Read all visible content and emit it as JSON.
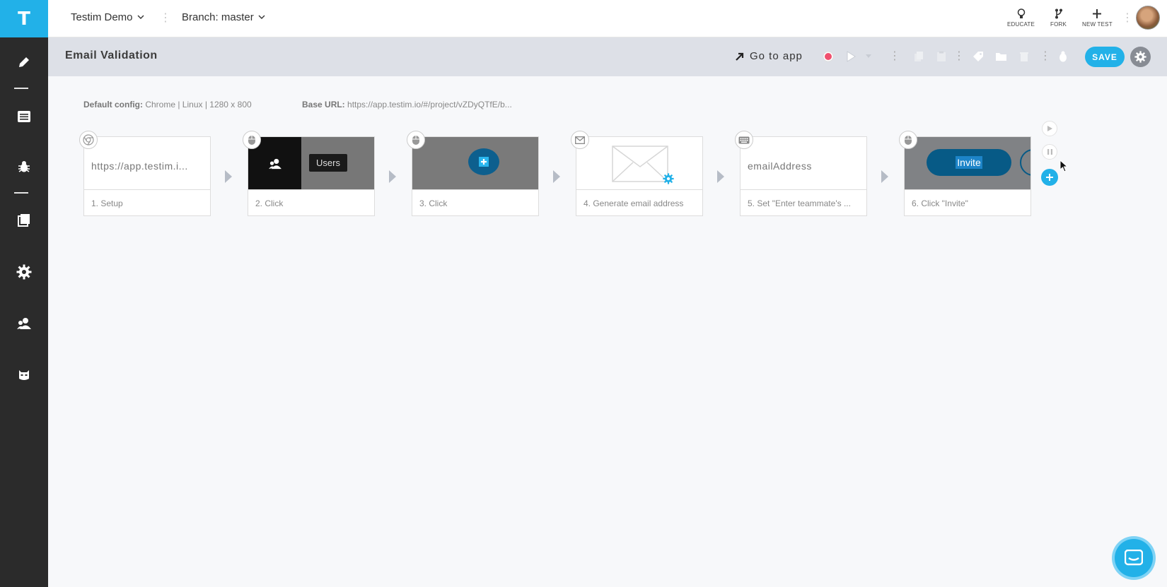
{
  "app": {
    "logo_letter": "T",
    "project": "Testim Demo",
    "branch": "Branch: master"
  },
  "top_actions": [
    {
      "label": "EDUCATE",
      "icon": "lightbulb-icon"
    },
    {
      "label": "FORK",
      "icon": "fork-icon"
    },
    {
      "label": "NEW TEST",
      "icon": "plus-icon"
    }
  ],
  "sidebar": {
    "items": [
      {
        "icon": "pencil-icon"
      },
      {
        "icon": "list-icon"
      },
      {
        "icon": "bug-icon"
      },
      {
        "icon": "suites-icon"
      },
      {
        "icon": "settings-gear-icon"
      },
      {
        "icon": "users-icon"
      },
      {
        "icon": "mask-icon"
      }
    ]
  },
  "test": {
    "title": "Email Validation",
    "go_to_app": "Go to app",
    "save_label": "SAVE"
  },
  "config": {
    "default_label": "Default config:",
    "default_value": "Chrome | Linux | 1280 x 800",
    "base_url_label": "Base URL:",
    "base_url_value": "https://app.testim.io/#/project/vZDyQTfE/b..."
  },
  "steps": [
    {
      "index": 1,
      "type": "setup",
      "badge_icon": "chrome-icon",
      "thumb_text": "https://app.testim.i...",
      "label": "1. Setup"
    },
    {
      "index": 2,
      "type": "click",
      "badge_icon": "mouse-icon",
      "thumb_tooltip": "Users",
      "label": "2. Click"
    },
    {
      "index": 3,
      "type": "click",
      "badge_icon": "mouse-icon",
      "label": "3. Click"
    },
    {
      "index": 4,
      "type": "generate",
      "badge_icon": "envelope-icon",
      "label": "4. Generate email address"
    },
    {
      "index": 5,
      "type": "set-text",
      "badge_icon": "keyboard-icon",
      "thumb_text": "emailAddress",
      "label": "5. Set \"Enter teammate's ..."
    },
    {
      "index": 6,
      "type": "click",
      "badge_icon": "mouse-icon",
      "thumb_button": "Invite",
      "label": "6. Click \"Invite\""
    }
  ],
  "colors": {
    "accent": "#22b1e8",
    "sidebar": "#2b2b2b",
    "record": "#f0506e"
  }
}
